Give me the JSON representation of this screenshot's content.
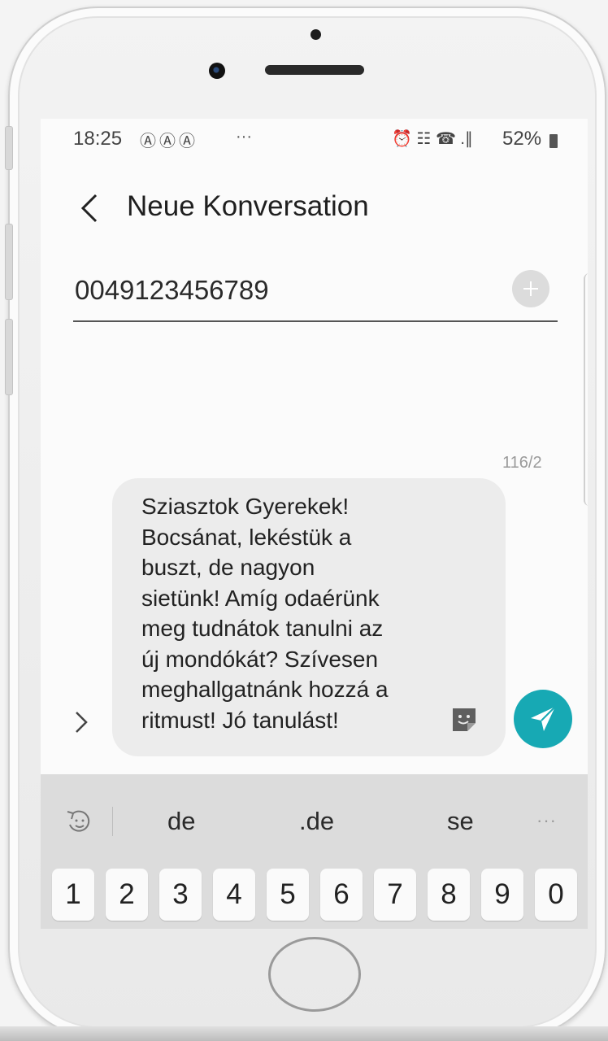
{
  "status_bar": {
    "time": "18:25",
    "notification_icons": "ⒶⒶⒶ",
    "overflow": "···",
    "system_icons": "⏰ ☷ ☎ .∥",
    "battery_percent": "52%"
  },
  "header": {
    "title": "Neue Konversation"
  },
  "recipient": {
    "value": "0049123456789"
  },
  "composer": {
    "counter": "116/2",
    "message": "Sziasztok Gyerekek!\nBocsánat, lekéstük a\nbuszt, de nagyon\nsietünk! Amíg odaérünk\nmeg tudnátok tanulni az\núj mondókát? Szívesen\nmeghallgatnánk hozzá a\nritmust! Jó tanulást!"
  },
  "keyboard": {
    "suggestions": [
      "de",
      ".de",
      "se"
    ],
    "more": "···",
    "number_keys": [
      "1",
      "2",
      "3",
      "4",
      "5",
      "6",
      "7",
      "8",
      "9",
      "0"
    ]
  },
  "colors": {
    "send_button": "#17a9b4",
    "composer_bg": "#ececec",
    "keyboard_bg": "#dcdcdc"
  }
}
